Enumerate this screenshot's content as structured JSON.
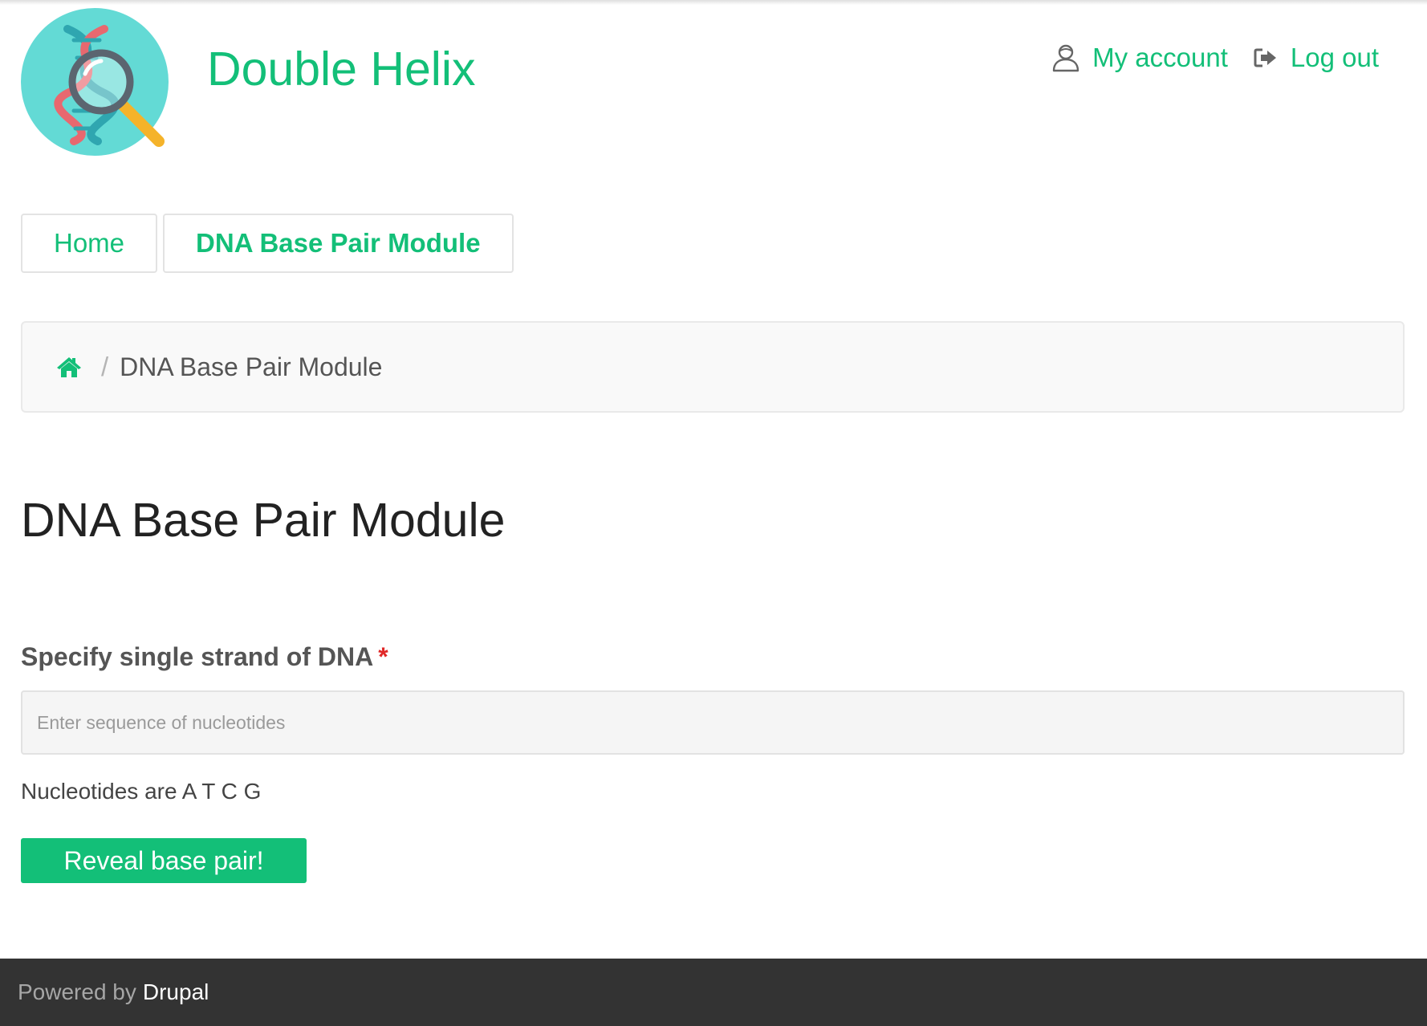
{
  "header": {
    "site_name": "Double Helix",
    "account_menu": {
      "my_account": "My account",
      "log_out": "Log out"
    }
  },
  "main_nav": {
    "items": [
      {
        "label": "Home",
        "active": false
      },
      {
        "label": "DNA Base Pair Module",
        "active": true
      }
    ]
  },
  "breadcrumb": {
    "separator": "/",
    "current": "DNA Base Pair Module"
  },
  "page": {
    "title": "DNA Base Pair Module"
  },
  "form": {
    "label": "Specify single strand of DNA",
    "required_mark": "*",
    "input_value": "",
    "input_placeholder": "Enter sequence of nucleotides",
    "description": "Nucleotides are A T C G",
    "submit_label": "Reveal base pair!"
  },
  "footer": {
    "powered_by": "Powered by",
    "link": "Drupal"
  },
  "icons": {
    "logo": "dna-magnifier-logo",
    "account": "user-icon",
    "logout": "sign-out-icon",
    "breadcrumb_home": "home-icon"
  },
  "colors": {
    "accent": "#13bf78",
    "footer_bg": "#333333",
    "required": "#e02828",
    "logo_circle": "#63dad5"
  }
}
